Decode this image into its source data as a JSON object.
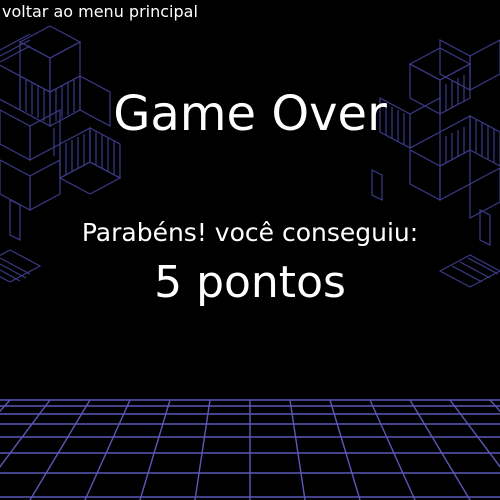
{
  "nav": {
    "back_label": "voltar ao menu principal"
  },
  "screen": {
    "title": "Game Over",
    "message": "Parabéns! você conseguiu:",
    "score_text": "5 pontos"
  },
  "theme": {
    "background": "#000000",
    "text": "#ffffff",
    "grid_line": "#5a58b8",
    "art_line": "#3c3a88"
  }
}
